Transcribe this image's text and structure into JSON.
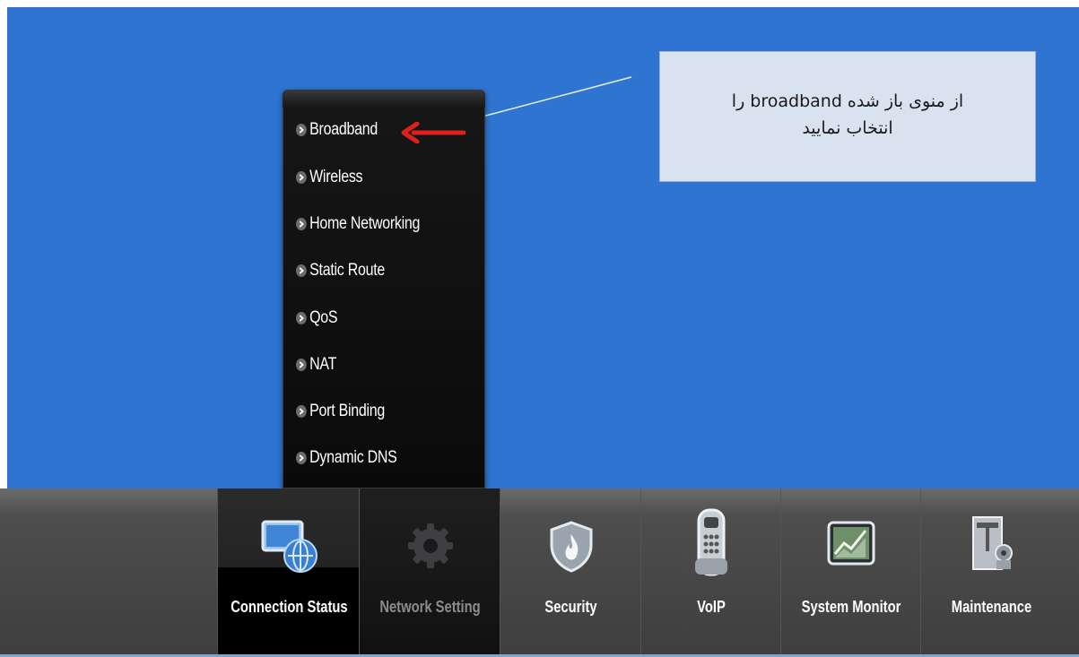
{
  "menu": {
    "items": [
      {
        "label": "Broadband"
      },
      {
        "label": "Wireless"
      },
      {
        "label": "Home Networking"
      },
      {
        "label": "Static Route"
      },
      {
        "label": "QoS"
      },
      {
        "label": "NAT"
      },
      {
        "label": "Port Binding"
      },
      {
        "label": "Dynamic DNS"
      }
    ]
  },
  "callout": {
    "line1": "از منوی باز شده broadband را",
    "line2": "انتخاب نمایید"
  },
  "nav": {
    "tabs": [
      {
        "label": "Connection Status",
        "icon": "monitor-globe-icon"
      },
      {
        "label": "Network Setting",
        "icon": "gear-icon"
      },
      {
        "label": "Security",
        "icon": "shield-icon"
      },
      {
        "label": "VoIP",
        "icon": "phone-icon"
      },
      {
        "label": "System Monitor",
        "icon": "chart-monitor-icon"
      },
      {
        "label": "Maintenance",
        "icon": "tools-icon"
      }
    ]
  },
  "colors": {
    "background": "#2f74d0",
    "menu": "#111111",
    "arrow": "#e0201b",
    "callout": "#d9e3f0",
    "navbar": "#4e4e4e"
  }
}
